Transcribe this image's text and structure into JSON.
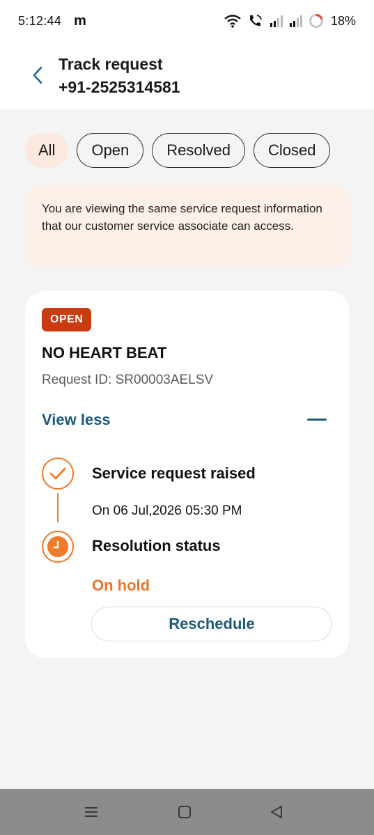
{
  "status_bar": {
    "time": "5:12:44",
    "carrier_logo": "m",
    "battery": "18%",
    "icons": [
      "wifi-icon",
      "wifi-calling-icon",
      "signal-icon",
      "signal-icon",
      "battery-icon"
    ]
  },
  "header": {
    "title_line1": "Track request",
    "title_line2": "+91-2525314581",
    "back_icon": "chevron-left-icon"
  },
  "filters": {
    "chips": [
      {
        "label": "All",
        "selected": true
      },
      {
        "label": "Open",
        "selected": false
      },
      {
        "label": "Resolved",
        "selected": false
      },
      {
        "label": "Closed",
        "selected": false
      }
    ]
  },
  "notice": {
    "text": "You are viewing the same service request information that our customer service associate can access."
  },
  "request_card": {
    "status_badge": "OPEN",
    "title": "NO HEART BEAT",
    "request_id": "Request ID: SR00003AELSV",
    "toggle_label": "View less",
    "timeline": [
      {
        "title": "Service request raised",
        "detail": "On 06 Jul,2026 05:30 PM",
        "icon": "check-circle-icon"
      },
      {
        "title": "Resolution status",
        "detail": "On hold",
        "icon": "clock-circle-icon"
      }
    ],
    "action_button": "Reschedule"
  },
  "colors": {
    "accent_orange": "#f07b2a",
    "badge_red": "#c93c12",
    "link_blue": "#1c5a7a",
    "chip_selected_bg": "#fbe9df",
    "notice_bg": "#fdf0e8"
  },
  "nav_bar": {
    "icons": [
      "menu-icon",
      "home-square-icon",
      "back-triangle-icon"
    ]
  }
}
